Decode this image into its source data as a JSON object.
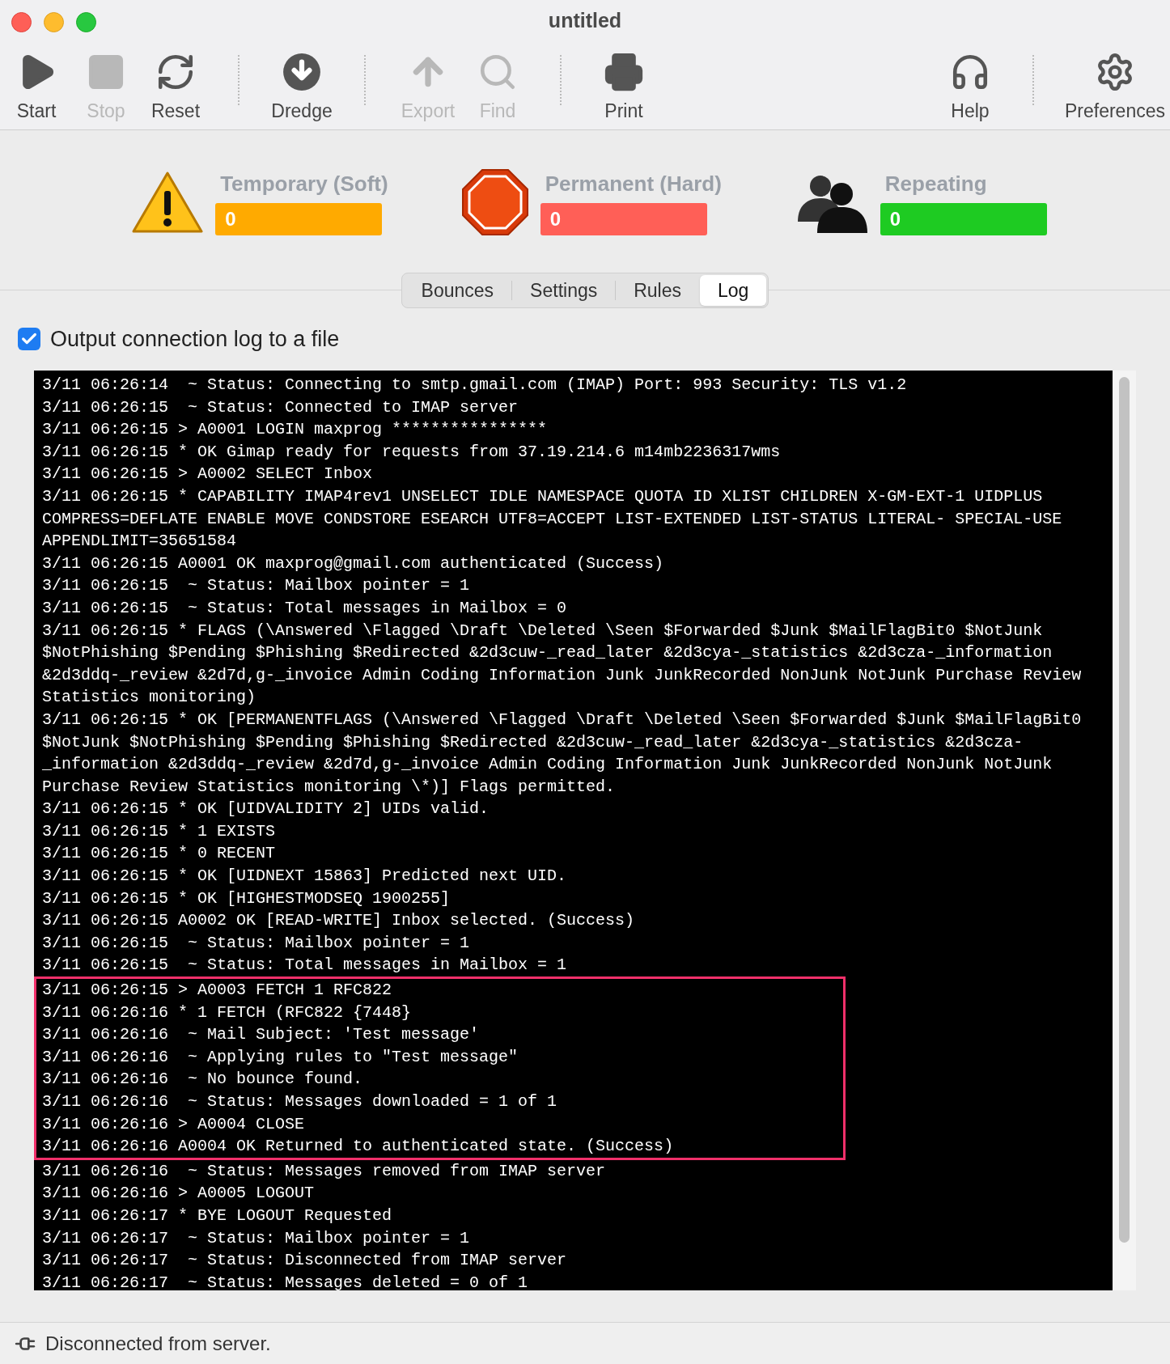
{
  "window": {
    "title": "untitled"
  },
  "toolbar": [
    {
      "kind": "button",
      "label": "Start",
      "disabled": false
    },
    {
      "kind": "button",
      "label": "Stop",
      "disabled": true
    },
    {
      "kind": "button",
      "label": "Reset",
      "disabled": false
    },
    {
      "kind": "separator"
    },
    {
      "kind": "button",
      "label": "Dredge",
      "disabled": false
    },
    {
      "kind": "separator"
    },
    {
      "kind": "button",
      "label": "Export",
      "disabled": true
    },
    {
      "kind": "button",
      "label": "Find",
      "disabled": true
    },
    {
      "kind": "separator"
    },
    {
      "kind": "button",
      "label": "Print",
      "disabled": false
    },
    {
      "kind": "space"
    },
    {
      "kind": "button",
      "label": "Help",
      "disabled": false
    },
    {
      "kind": "separator"
    },
    {
      "kind": "button",
      "label": "Preferences",
      "disabled": false
    }
  ],
  "counters": [
    {
      "label": "Temporary (Soft)",
      "value": "0",
      "color": "#ffaa00"
    },
    {
      "label": "Permanent (Hard)",
      "value": "0",
      "color": "#ff5f57"
    },
    {
      "label": "Repeating",
      "value": "0",
      "color": "#1ecb22"
    }
  ],
  "tabs": [
    {
      "label": "Bounces",
      "selected": false
    },
    {
      "label": "Settings",
      "selected": false
    },
    {
      "label": "Rules",
      "selected": false
    },
    {
      "label": "Log",
      "selected": true
    }
  ],
  "log_to_file": {
    "label": "Output connection log to a file",
    "checked": true
  },
  "log": [
    {
      "text": "3/11 06:26:14  ~ Status: Connecting to smtp.gmail.com (IMAP) Port: 993 Security: TLS v1.2",
      "highlighted": false
    },
    {
      "text": "3/11 06:26:15  ~ Status: Connected to IMAP server",
      "highlighted": false
    },
    {
      "text": "3/11 06:26:15 > A0001 LOGIN maxprog ****************",
      "highlighted": false
    },
    {
      "text": "3/11 06:26:15 * OK Gimap ready for requests from 37.19.214.6 m14mb2236317wms",
      "highlighted": false
    },
    {
      "text": "3/11 06:26:15 > A0002 SELECT Inbox",
      "highlighted": false
    },
    {
      "text": "3/11 06:26:15 * CAPABILITY IMAP4rev1 UNSELECT IDLE NAMESPACE QUOTA ID XLIST CHILDREN X-GM-EXT-1 UIDPLUS COMPRESS=DEFLATE ENABLE MOVE CONDSTORE ESEARCH UTF8=ACCEPT LIST-EXTENDED LIST-STATUS LITERAL- SPECIAL-USE APPENDLIMIT=35651584",
      "highlighted": false
    },
    {
      "text": "3/11 06:26:15 A0001 OK maxprog@gmail.com authenticated (Success)",
      "highlighted": false
    },
    {
      "text": "3/11 06:26:15  ~ Status: Mailbox pointer = 1",
      "highlighted": false
    },
    {
      "text": "3/11 06:26:15  ~ Status: Total messages in Mailbox = 0",
      "highlighted": false
    },
    {
      "text": "3/11 06:26:15 * FLAGS (\\Answered \\Flagged \\Draft \\Deleted \\Seen $Forwarded $Junk $MailFlagBit0 $NotJunk $NotPhishing $Pending $Phishing $Redirected &2d3cuw-_read_later &2d3cya-_statistics &2d3cza-_information &2d3ddq-_review &2d7d,g-_invoice Admin Coding Information Junk JunkRecorded NonJunk NotJunk Purchase Review Statistics monitoring)",
      "highlighted": false
    },
    {
      "text": "3/11 06:26:15 * OK [PERMANENTFLAGS (\\Answered \\Flagged \\Draft \\Deleted \\Seen $Forwarded $Junk $MailFlagBit0 $NotJunk $NotPhishing $Pending $Phishing $Redirected &2d3cuw-_read_later &2d3cya-_statistics &2d3cza-_information &2d3ddq-_review &2d7d,g-_invoice Admin Coding Information Junk JunkRecorded NonJunk NotJunk Purchase Review Statistics monitoring \\*)] Flags permitted.",
      "highlighted": false
    },
    {
      "text": "3/11 06:26:15 * OK [UIDVALIDITY 2] UIDs valid.",
      "highlighted": false
    },
    {
      "text": "3/11 06:26:15 * 1 EXISTS",
      "highlighted": false
    },
    {
      "text": "3/11 06:26:15 * 0 RECENT",
      "highlighted": false
    },
    {
      "text": "3/11 06:26:15 * OK [UIDNEXT 15863] Predicted next UID.",
      "highlighted": false
    },
    {
      "text": "3/11 06:26:15 * OK [HIGHESTMODSEQ 1900255]",
      "highlighted": false
    },
    {
      "text": "3/11 06:26:15 A0002 OK [READ-WRITE] Inbox selected. (Success)",
      "highlighted": false
    },
    {
      "text": "3/11 06:26:15  ~ Status: Mailbox pointer = 1",
      "highlighted": false
    },
    {
      "text": "3/11 06:26:15  ~ Status: Total messages in Mailbox = 1",
      "highlighted": false
    },
    {
      "text": "3/11 06:26:15 > A0003 FETCH 1 RFC822",
      "highlighted": true
    },
    {
      "text": "3/11 06:26:16 * 1 FETCH (RFC822 {7448}",
      "highlighted": true
    },
    {
      "text": "3/11 06:26:16  ~ Mail Subject: 'Test message'",
      "highlighted": true
    },
    {
      "text": "3/11 06:26:16  ~ Applying rules to \"Test message\"",
      "highlighted": true
    },
    {
      "text": "3/11 06:26:16  ~ No bounce found.",
      "highlighted": true
    },
    {
      "text": "3/11 06:26:16  ~ Status: Messages downloaded = 1 of 1",
      "highlighted": true
    },
    {
      "text": "3/11 06:26:16 > A0004 CLOSE",
      "highlighted": true
    },
    {
      "text": "3/11 06:26:16 A0004 OK Returned to authenticated state. (Success)",
      "highlighted": true
    },
    {
      "text": "3/11 06:26:16  ~ Status: Messages removed from IMAP server",
      "highlighted": false
    },
    {
      "text": "3/11 06:26:16 > A0005 LOGOUT",
      "highlighted": false
    },
    {
      "text": "3/11 06:26:17 * BYE LOGOUT Requested",
      "highlighted": false
    },
    {
      "text": "3/11 06:26:17  ~ Status: Mailbox pointer = 1",
      "highlighted": false
    },
    {
      "text": "3/11 06:26:17  ~ Status: Disconnected from IMAP server",
      "highlighted": false
    },
    {
      "text": "3/11 06:26:17  ~ Status: Messages deleted = 0 of 1",
      "highlighted": false
    }
  ],
  "status_bar": {
    "text": "Disconnected from server."
  }
}
